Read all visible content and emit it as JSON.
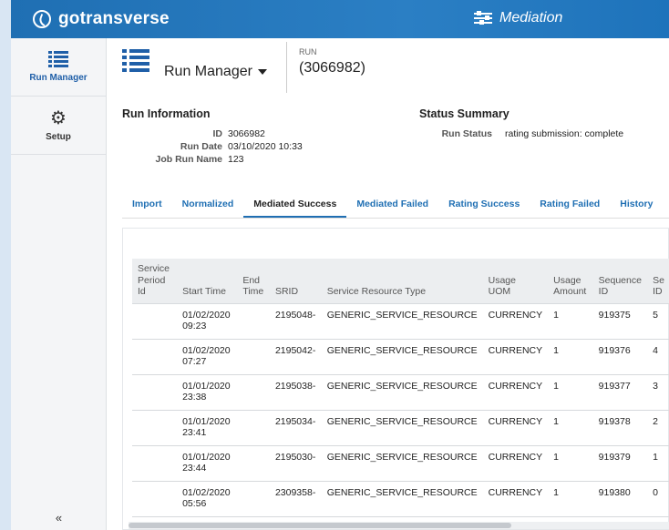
{
  "app": {
    "logo_text": "gotransverse",
    "module_title": "Mediation"
  },
  "sidebar": {
    "items": [
      {
        "label": "Run Manager",
        "icon": "list-icon",
        "active": true
      },
      {
        "label": "Setup",
        "icon": "gears-icon",
        "active": false
      }
    ],
    "collapse_label": "«"
  },
  "header": {
    "title": "Run Manager",
    "run_label": "RUN",
    "run_id": "(3066982)"
  },
  "run_info": {
    "title": "Run Information",
    "fields": [
      {
        "key": "ID",
        "value": "3066982"
      },
      {
        "key": "Run Date",
        "value": "03/10/2020 10:33"
      },
      {
        "key": "Job Run Name",
        "value": "123"
      }
    ]
  },
  "status_summary": {
    "title": "Status Summary",
    "key": "Run Status",
    "value": "rating submission: complete"
  },
  "tabs": [
    {
      "label": "Import",
      "active": false
    },
    {
      "label": "Normalized",
      "active": false
    },
    {
      "label": "Mediated Success",
      "active": true
    },
    {
      "label": "Mediated Failed",
      "active": false
    },
    {
      "label": "Rating Success",
      "active": false
    },
    {
      "label": "Rating Failed",
      "active": false
    },
    {
      "label": "History",
      "active": false
    }
  ],
  "table": {
    "headers": [
      [
        "Service",
        "Period",
        "Id"
      ],
      [
        "Start Time"
      ],
      [
        "End",
        "Time"
      ],
      [
        "SRID"
      ],
      [
        "Service Resource Type"
      ],
      [
        "Usage",
        "UOM"
      ],
      [
        "Usage",
        "Amount"
      ],
      [
        "Sequence",
        "ID"
      ],
      [
        "Se",
        "ID"
      ]
    ],
    "rows": [
      [
        "",
        "01/02/2020 09:23",
        "",
        "2195048-",
        "GENERIC_SERVICE_RESOURCE",
        "CURRENCY",
        "1",
        "919375",
        "5"
      ],
      [
        "",
        "01/02/2020 07:27",
        "",
        "2195042-",
        "GENERIC_SERVICE_RESOURCE",
        "CURRENCY",
        "1",
        "919376",
        "4"
      ],
      [
        "",
        "01/01/2020 23:38",
        "",
        "2195038-",
        "GENERIC_SERVICE_RESOURCE",
        "CURRENCY",
        "1",
        "919377",
        "3"
      ],
      [
        "",
        "01/01/2020 23:41",
        "",
        "2195034-",
        "GENERIC_SERVICE_RESOURCE",
        "CURRENCY",
        "1",
        "919378",
        "2"
      ],
      [
        "",
        "01/01/2020 23:44",
        "",
        "2195030-",
        "GENERIC_SERVICE_RESOURCE",
        "CURRENCY",
        "1",
        "919379",
        "1"
      ],
      [
        "",
        "01/02/2020 05:56",
        "",
        "2309358-",
        "GENERIC_SERVICE_RESOURCE",
        "CURRENCY",
        "1",
        "919380",
        "0"
      ]
    ]
  },
  "colors": {
    "brand_blue": "#1f6fb3",
    "active_tab_underline": "#1f6fb3"
  }
}
